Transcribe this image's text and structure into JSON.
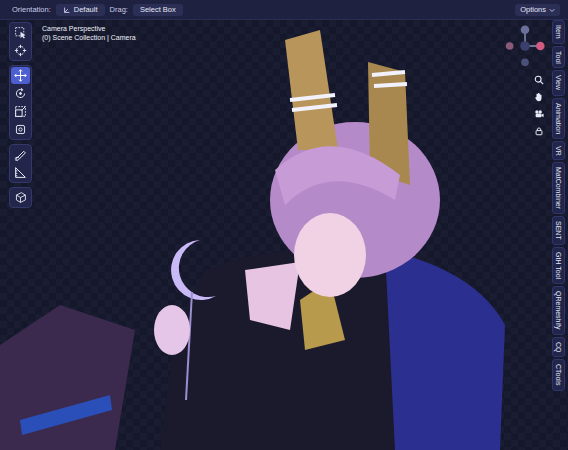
{
  "header": {
    "orientation_label": "Orientation:",
    "orientation_value": "Default",
    "drag_label": "Drag:",
    "drag_value": "Select Box",
    "options": "Options"
  },
  "viewport": {
    "view_name": "Camera Perspective",
    "collection": "(0) Scene Collection | Camera"
  },
  "toolbar": {
    "groups": [
      {
        "tools": [
          {
            "kind": "select",
            "selected": false
          },
          {
            "kind": "cursor",
            "selected": false
          }
        ]
      },
      {
        "tools": [
          {
            "kind": "move",
            "selected": true
          },
          {
            "kind": "rotate",
            "selected": false
          },
          {
            "kind": "scale",
            "selected": false
          },
          {
            "kind": "transform",
            "selected": false
          }
        ]
      },
      {
        "tools": [
          {
            "kind": "annotate",
            "selected": false
          },
          {
            "kind": "measure",
            "selected": false
          }
        ]
      },
      {
        "tools": [
          {
            "kind": "add-cube",
            "selected": false
          }
        ]
      }
    ]
  },
  "navigation": [
    {
      "kind": "zoom"
    },
    {
      "kind": "hand"
    },
    {
      "kind": "camera"
    },
    {
      "kind": "lock"
    }
  ],
  "sidebar_tabs": [
    {
      "label": "Item",
      "selected": false
    },
    {
      "label": "Tool",
      "selected": false
    },
    {
      "label": "View",
      "selected": false
    },
    {
      "label": "Animation",
      "selected": false
    },
    {
      "label": "VR",
      "selected": false
    },
    {
      "label": "MatCombiner",
      "selected": false
    },
    {
      "label": "SENT",
      "selected": false
    },
    {
      "label": "GtH Tool",
      "selected": false
    },
    {
      "label": "QRemeshify",
      "selected": false
    },
    {
      "label": "CQ",
      "selected": false
    },
    {
      "label": "CTools",
      "selected": false
    }
  ]
}
